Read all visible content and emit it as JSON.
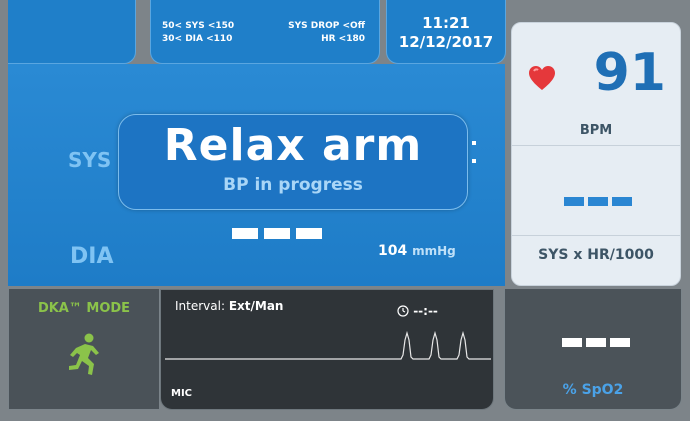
{
  "limits": {
    "sys_range": "50< SYS <150",
    "dia_range": "30< DIA <110",
    "sys_drop": "SYS DROP <Off",
    "hr_limit": "HR <180"
  },
  "clock": {
    "time": "11:21",
    "date": "12/12/2017"
  },
  "bp": {
    "sys_label": "SYS",
    "dia_label": "DIA",
    "popup_title": "Relax arm",
    "popup_subtitle": "BP in progress",
    "pressure_value": "104",
    "pressure_unit": "mmHg"
  },
  "hr": {
    "value": "91",
    "unit": "BPM",
    "shr_label": "SYS x HR/1000"
  },
  "dka": {
    "label": "DKA™ MODE"
  },
  "waveform": {
    "interval_label": "Interval:",
    "interval_value": "Ext/Man",
    "timer": "--:--",
    "source": "MIC"
  },
  "spo2": {
    "label": "% SpO2"
  },
  "colors": {
    "panel_blue": "#1f7fc9",
    "hr_blue": "#1f6fb5",
    "dka_green": "#8bc34a",
    "heart_red": "#e5383b"
  },
  "icons": [
    "heart-icon",
    "running-man-icon",
    "stopwatch-icon"
  ]
}
